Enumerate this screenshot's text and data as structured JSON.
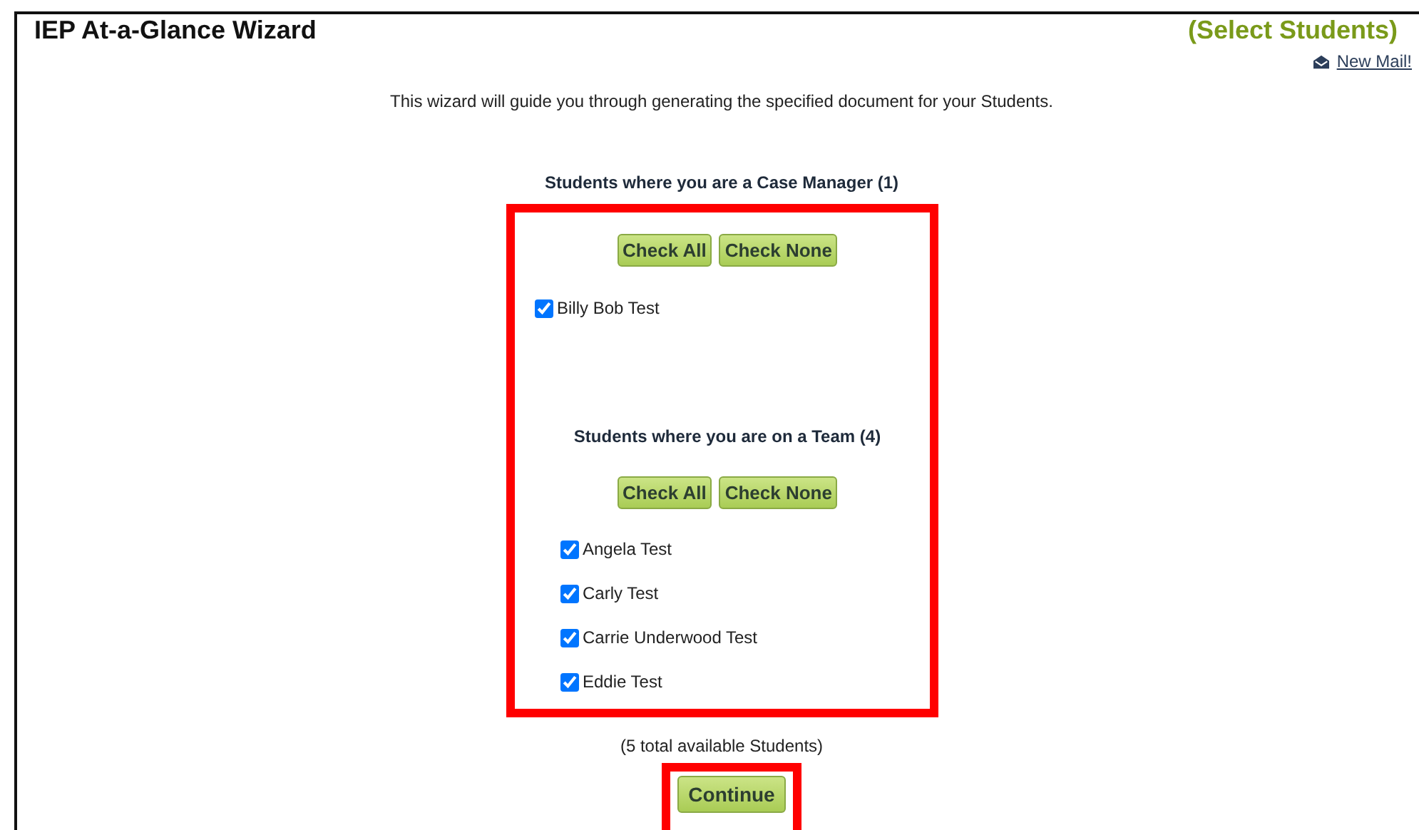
{
  "title": "IEP At-a-Glance Wizard",
  "step": "(Select Students)",
  "mail_link": "New Mail!",
  "intro": "This wizard will guide you through generating the specified document for your Students.",
  "sections": [
    {
      "heading": "Students where you are a Case Manager (1)",
      "buttons": [
        "Check All",
        "Check None"
      ],
      "students": [
        {
          "name": "Billy Bob Test",
          "checked": true
        }
      ]
    },
    {
      "heading": "Students where you are on a Team (4)",
      "buttons": [
        "Check All",
        "Check None"
      ],
      "students": [
        {
          "name": "Angela Test",
          "checked": true
        },
        {
          "name": "Carly Test",
          "checked": true
        },
        {
          "name": "Carrie Underwood Test",
          "checked": true
        },
        {
          "name": "Eddie Test",
          "checked": true
        }
      ]
    }
  ],
  "total": "(5 total available Students)",
  "continue_button": "Continue"
}
